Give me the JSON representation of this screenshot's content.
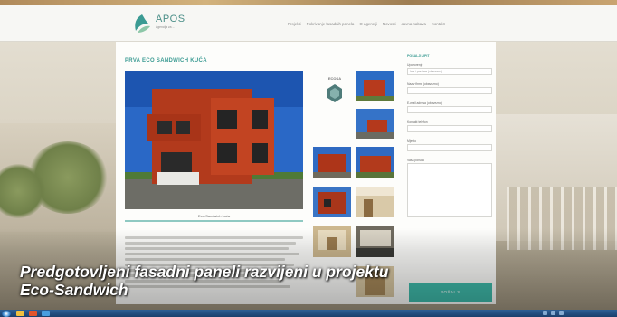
{
  "site": {
    "logo_text": "APOS",
    "logo_subtitle": "Agencija za ..."
  },
  "nav": {
    "items": [
      "Projekti",
      "Pokrivanje fasadnih panela",
      "O agenciji",
      "Novosti",
      "Javna nabava",
      "Kontakt"
    ]
  },
  "page": {
    "title": "PRVA ECO SANDWICH KUĆA",
    "photo_caption": "Eco-Sandwich kuća",
    "eco_logo_text": "ECOSA"
  },
  "form": {
    "title": "POŠALJI UPIT",
    "fields": [
      {
        "label": "Upozorenje",
        "value": "Ime i prezime (obavezno)"
      },
      {
        "label": "Naziv firme (obavezno)",
        "value": ""
      },
      {
        "label": "E-mail adresa (obavezno)",
        "value": ""
      },
      {
        "label": "Kontakt telefon",
        "value": ""
      },
      {
        "label": "Mjesto",
        "value": ""
      }
    ],
    "message_label": "Vaša poruka",
    "submit_label": "POŠALJI"
  },
  "overlay": {
    "caption_line1": "Predgotovljeni fasadni paneli razvijeni u projektu",
    "caption_line2": "Eco-Sandwich"
  },
  "colors": {
    "accent": "#3fbbab",
    "heading": "#3b9b93",
    "taskbar": "#1a3f6c"
  }
}
